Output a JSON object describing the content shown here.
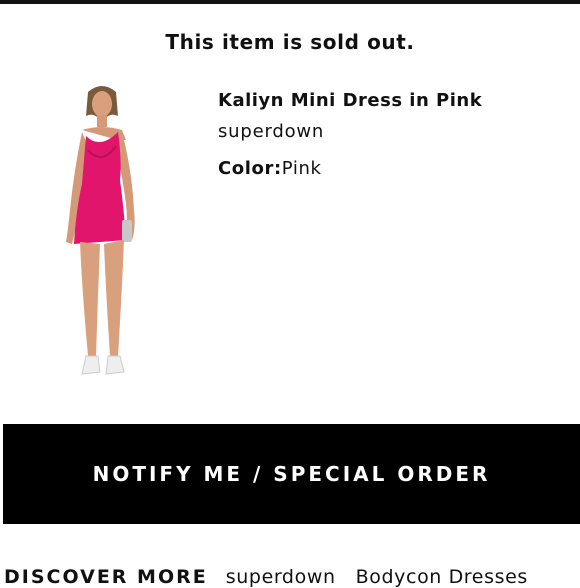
{
  "header": {
    "sold_out_message": "This item is sold out."
  },
  "product": {
    "name": "Kaliyn Mini Dress in Pink",
    "brand": "superdown",
    "color_label": "Color:",
    "color_value": "Pink",
    "dress_color": "#e0156b"
  },
  "actions": {
    "notify_label": "NOTIFY ME / SPECIAL ORDER"
  },
  "discover": {
    "heading": "DISCOVER MORE",
    "links": [
      "superdown",
      "Bodycon Dresses"
    ]
  },
  "colors": {
    "button_bg": "#000000",
    "button_text": "#ffffff",
    "text": "#111111"
  }
}
